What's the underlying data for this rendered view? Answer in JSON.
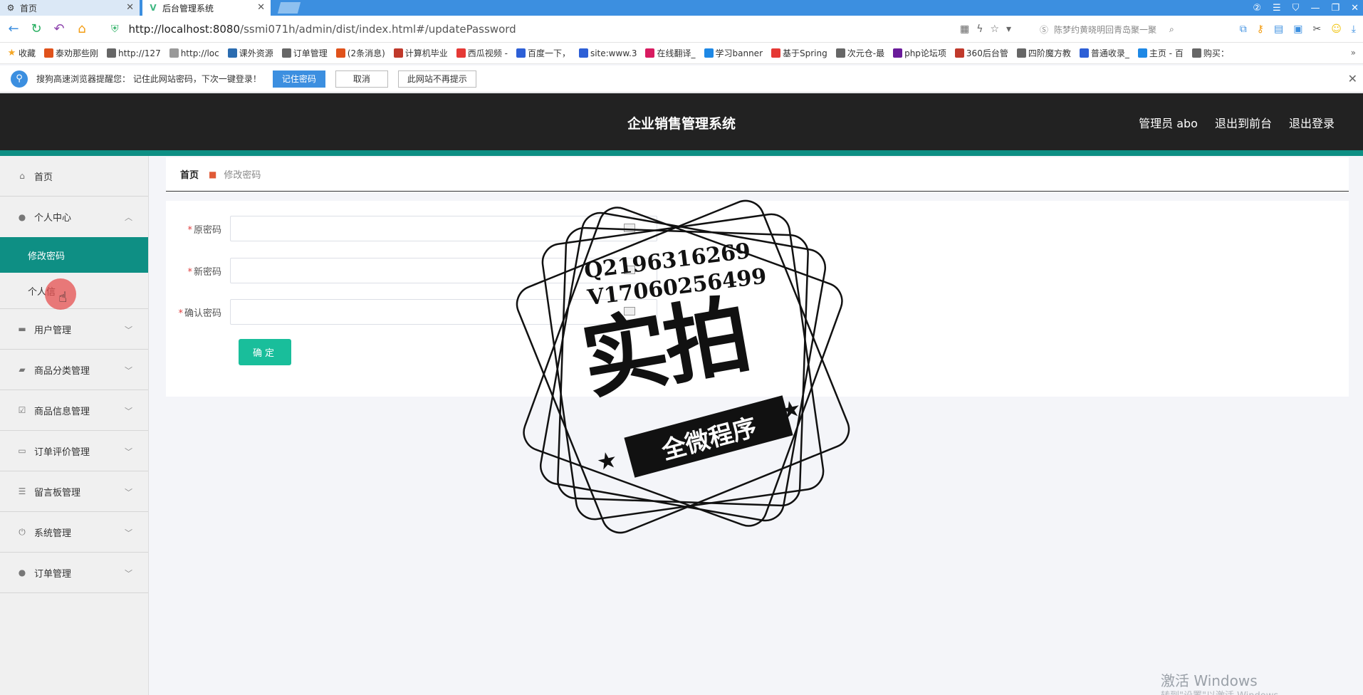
{
  "browser": {
    "tabs": [
      {
        "label": "首页",
        "icon": "gear-icon"
      },
      {
        "label": "后台管理系统",
        "icon": "vue-icon"
      }
    ],
    "url": {
      "host": "http://localhost:8080",
      "path": "/ssmi071h/admin/dist/index.html#/updatePassword"
    },
    "search_hint": "陈梦约黄晓明回青岛聚一聚",
    "bookmarks": [
      {
        "label": "收藏",
        "color": "#f5a623"
      },
      {
        "label": "泰劝那些刚",
        "color": "#e0521b"
      },
      {
        "label": "http://127",
        "color": "#666666"
      },
      {
        "label": "http://loc",
        "color": "#999999"
      },
      {
        "label": "课外资源",
        "color": "#2b6cb0"
      },
      {
        "label": "订单管理",
        "color": "#666666"
      },
      {
        "label": "(2条消息)",
        "color": "#e0521b"
      },
      {
        "label": "计算机毕业",
        "color": "#c0392b"
      },
      {
        "label": "西瓜视频 -",
        "color": "#e53935"
      },
      {
        "label": "百度一下，",
        "color": "#2d5fd6"
      },
      {
        "label": "site:www.3",
        "color": "#2d5fd6"
      },
      {
        "label": "在线翻译_",
        "color": "#d81b60"
      },
      {
        "label": "学习banner",
        "color": "#1e88e5"
      },
      {
        "label": "基于Spring",
        "color": "#e53935"
      },
      {
        "label": "次元仓-最",
        "color": "#666666"
      },
      {
        "label": "php论坛项",
        "color": "#6a1b9a"
      },
      {
        "label": "360后台管",
        "color": "#c0392b"
      },
      {
        "label": "四阶魔方教",
        "color": "#666666"
      },
      {
        "label": "普通收录_",
        "color": "#2d5fd6"
      },
      {
        "label": "主页 - 百",
        "color": "#1e88e5"
      },
      {
        "label": "购买：",
        "color": "#666666"
      }
    ],
    "notify": {
      "text": "搜狗高速浏览器提醒您：  记住此网站密码，下次一键登录！",
      "remember": "记住密码",
      "cancel": "取消",
      "never": "此网站不再提示"
    }
  },
  "header": {
    "title": "企业销售管理系统",
    "admin": "管理员 abo",
    "to_front": "退出到前台",
    "logout": "退出登录"
  },
  "sidebar": {
    "home": "首页",
    "personal": "个人中心",
    "sub_change_pwd": "修改密码",
    "sub_info": "个人信",
    "users": "用户管理",
    "category": "商品分类管理",
    "goods": "商品信息管理",
    "reviews": "订单评价管理",
    "messages": "留言板管理",
    "system": "系统管理",
    "orders": "订单管理"
  },
  "breadcrumb": {
    "home": "首页",
    "current": "修改密码"
  },
  "form": {
    "old_pwd": "原密码",
    "new_pwd": "新密码",
    "confirm_pwd": "确认密码",
    "submit": "确定"
  },
  "watermark": {
    "line1": "Q2196316269",
    "line2": "V17060256499",
    "big": "实拍",
    "ribbon": "全微程序"
  },
  "os_watermark": {
    "title": "激活 Windows",
    "sub": "转到\"设置\"以激活 Windows。"
  },
  "colors": {
    "accent": "#0e8f84",
    "header_bg": "#222222",
    "button": "#19be9b"
  }
}
